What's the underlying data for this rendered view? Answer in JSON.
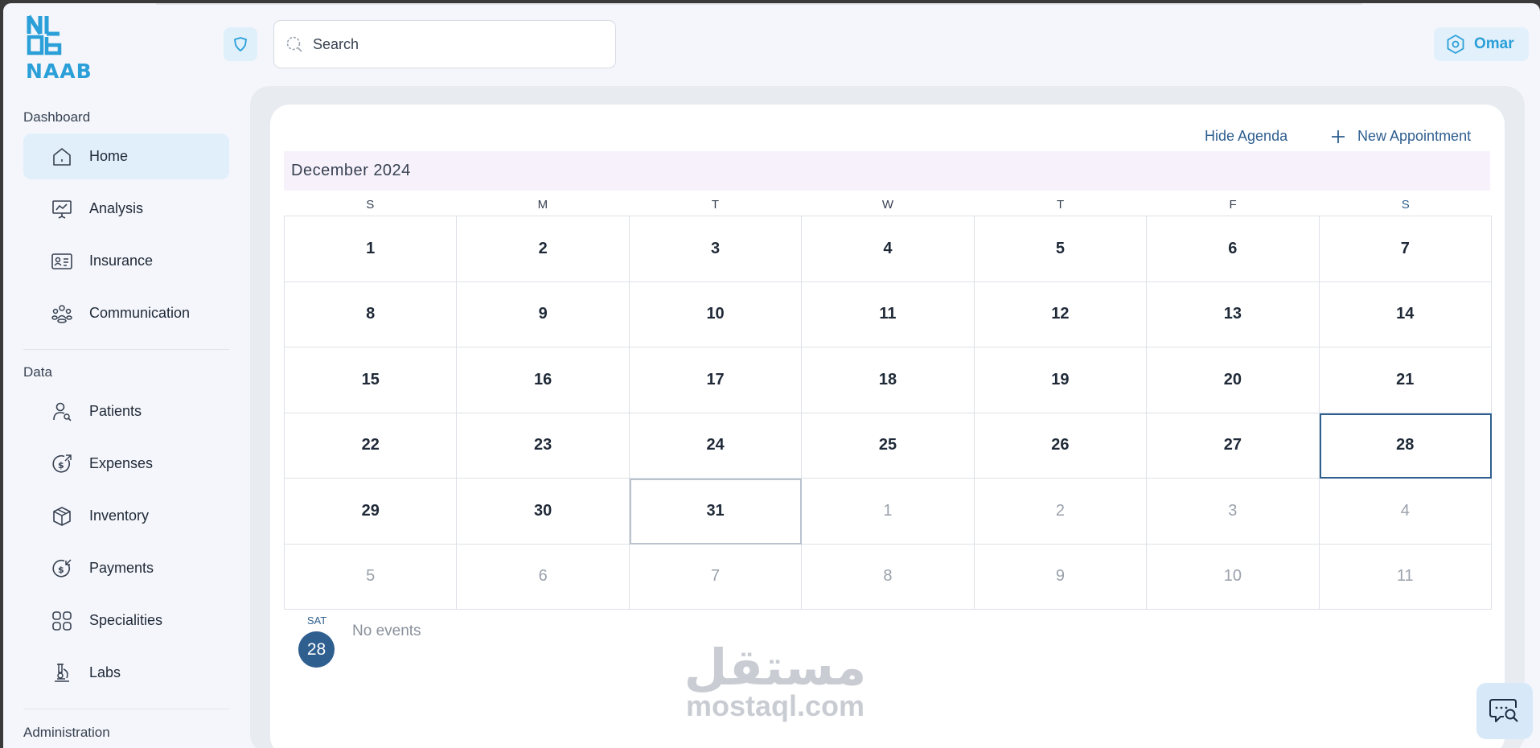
{
  "brand": {
    "name": "NAAB",
    "color": "#2a9fd8"
  },
  "search": {
    "placeholder": "Search",
    "value": ""
  },
  "user": {
    "name": "Omar"
  },
  "sidebar": {
    "sections": [
      {
        "label": "Dashboard"
      },
      {
        "label": "Data"
      },
      {
        "label": "Administration"
      }
    ],
    "items": [
      {
        "label": "Home",
        "icon": "home-icon",
        "active": true
      },
      {
        "label": "Analysis",
        "icon": "presentation-chart-icon"
      },
      {
        "label": "Insurance",
        "icon": "id-card-icon"
      },
      {
        "label": "Communication",
        "icon": "group-icon"
      },
      {
        "label": "Patients",
        "icon": "user-search-icon"
      },
      {
        "label": "Expenses",
        "icon": "dollar-out-icon"
      },
      {
        "label": "Inventory",
        "icon": "box-icon"
      },
      {
        "label": "Payments",
        "icon": "dollar-in-icon"
      },
      {
        "label": "Specialities",
        "icon": "grid-icon"
      },
      {
        "label": "Labs",
        "icon": "microscope-icon"
      }
    ]
  },
  "calendar": {
    "hide_agenda": "Hide Agenda",
    "new_appointment": "New Appointment",
    "month_label": "December 2024",
    "weekdays": [
      "S",
      "M",
      "T",
      "W",
      "T",
      "F",
      "S"
    ],
    "days": [
      "1",
      "2",
      "3",
      "4",
      "5",
      "6",
      "7",
      "8",
      "9",
      "10",
      "11",
      "12",
      "13",
      "14",
      "15",
      "16",
      "17",
      "18",
      "19",
      "20",
      "21",
      "22",
      "23",
      "24",
      "25",
      "26",
      "27",
      "28",
      "29",
      "30",
      "31",
      "1",
      "2",
      "3",
      "4",
      "5",
      "6",
      "7",
      "8",
      "9",
      "10",
      "11"
    ],
    "outside_from_index": 31,
    "selected_index": 27,
    "today_index": 30
  },
  "agenda": {
    "dow": "SAT",
    "day": "28",
    "empty_text": "No events"
  },
  "watermark": {
    "logo": "مستقل",
    "text": "mostaql.com"
  },
  "colors": {
    "accent": "#2f5f8f",
    "active_bg": "#e1effb"
  }
}
